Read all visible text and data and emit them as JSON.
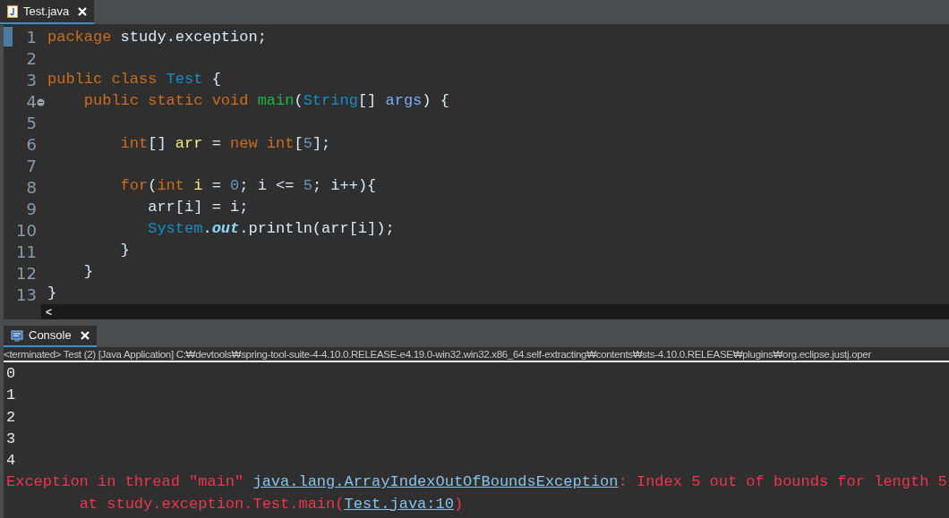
{
  "editor": {
    "tab": {
      "label": "Test.java",
      "selected": true
    },
    "lines": [
      {
        "number": "1",
        "foldable": false,
        "tokens": [
          {
            "text": "package",
            "kind": "keyword"
          },
          {
            "text": " study.exception;",
            "kind": "plain"
          }
        ]
      },
      {
        "number": "2",
        "foldable": false
      },
      {
        "number": "3",
        "foldable": false,
        "tokens": [
          {
            "text": "public class",
            "kind": "keyword"
          },
          {
            "text": " Test",
            "kind": "type"
          },
          {
            "text": " {",
            "kind": "plain"
          }
        ]
      },
      {
        "number": "4",
        "foldable": true,
        "tokens": [
          {
            "text": "    public static void",
            "kind": "keyword"
          },
          {
            "text": " main",
            "kind": "method"
          },
          {
            "text": "(",
            "kind": "plain"
          },
          {
            "text": "String",
            "kind": "type"
          },
          {
            "text": "[] ",
            "kind": "plain"
          },
          {
            "text": "args",
            "kind": "param"
          },
          {
            "text": ") {",
            "kind": "plain"
          }
        ]
      },
      {
        "number": "5",
        "foldable": false
      },
      {
        "number": "6",
        "foldable": false,
        "tokens": [
          {
            "text": "        int",
            "kind": "keyword"
          },
          {
            "text": "[] ",
            "kind": "plain"
          },
          {
            "text": "arr",
            "kind": "local"
          },
          {
            "text": " = ",
            "kind": "plain"
          },
          {
            "text": "new int",
            "kind": "keyword"
          },
          {
            "text": "[",
            "kind": "plain"
          },
          {
            "text": "5",
            "kind": "number"
          },
          {
            "text": "];",
            "kind": "plain"
          }
        ]
      },
      {
        "number": "7",
        "foldable": false
      },
      {
        "number": "8",
        "foldable": false,
        "tokens": [
          {
            "text": "        for",
            "kind": "keyword"
          },
          {
            "text": "(",
            "kind": "plain"
          },
          {
            "text": "int",
            "kind": "keyword"
          },
          {
            "text": " i",
            "kind": "local"
          },
          {
            "text": " = ",
            "kind": "plain"
          },
          {
            "text": "0",
            "kind": "number"
          },
          {
            "text": "; i <= ",
            "kind": "plain"
          },
          {
            "text": "5",
            "kind": "number"
          },
          {
            "text": "; i++){",
            "kind": "plain"
          }
        ]
      },
      {
        "number": "9",
        "foldable": false,
        "tokens": [
          {
            "text": "           arr[i] = i;",
            "kind": "plain"
          }
        ]
      },
      {
        "number": "10",
        "foldable": false,
        "tokens": [
          {
            "text": "           System",
            "kind": "type"
          },
          {
            "text": ".",
            "kind": "plain"
          },
          {
            "text": "out",
            "kind": "field"
          },
          {
            "text": ".println(arr[i]);",
            "kind": "plain"
          }
        ]
      },
      {
        "number": "11",
        "foldable": false,
        "tokens": [
          {
            "text": "        }",
            "kind": "plain"
          }
        ]
      },
      {
        "number": "12",
        "foldable": false,
        "tokens": [
          {
            "text": "    }",
            "kind": "plain"
          }
        ]
      },
      {
        "number": "13",
        "foldable": false,
        "tokens": [
          {
            "text": "}",
            "kind": "plain"
          }
        ]
      }
    ],
    "scroll_left": "<"
  },
  "console": {
    "tab": {
      "label": "Console",
      "selected": true
    },
    "status": "<terminated> Test (2) [Java Application] C:₩devtools₩spring-tool-suite-4-4.10.0.RELEASE-e4.19.0-win32.win32.x86_64.self-extracting₩contents₩sts-4.10.0.RELEASE₩plugins₩org.eclipse.justj.oper",
    "lines": [
      {
        "kind": "stdout",
        "segments": [
          {
            "text": "0",
            "link": false
          }
        ]
      },
      {
        "kind": "stdout",
        "segments": [
          {
            "text": "1",
            "link": false
          }
        ]
      },
      {
        "kind": "stdout",
        "segments": [
          {
            "text": "2",
            "link": false
          }
        ]
      },
      {
        "kind": "stdout",
        "segments": [
          {
            "text": "3",
            "link": false
          }
        ]
      },
      {
        "kind": "stdout",
        "segments": [
          {
            "text": "4",
            "link": false
          }
        ]
      },
      {
        "kind": "stderr",
        "segments": [
          {
            "text": "Exception in thread \"main\" ",
            "link": false
          },
          {
            "text": "java.lang.ArrayIndexOutOfBoundsException",
            "link": true
          },
          {
            "text": ": Index 5 out of bounds for length 5",
            "link": false
          }
        ]
      },
      {
        "kind": "stderr",
        "segments": [
          {
            "text": "\tat study.exception.Test.main(",
            "link": false
          },
          {
            "text": "Test.java:10",
            "link": true
          },
          {
            "text": ")",
            "link": false
          }
        ]
      }
    ]
  }
}
